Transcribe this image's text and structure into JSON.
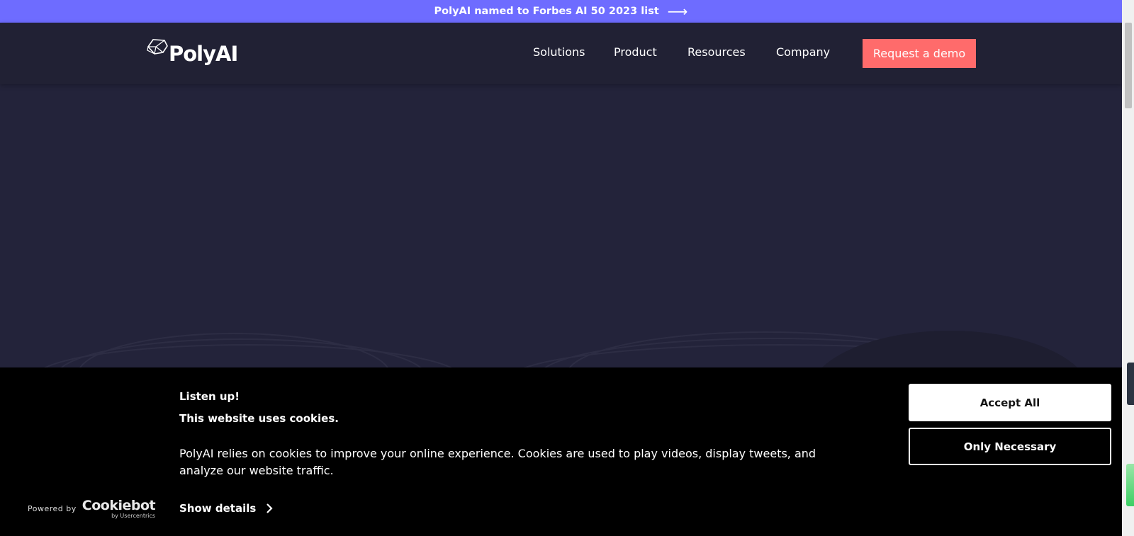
{
  "announcement": {
    "text": "PolyAI named to Forbes AI 50 2023 list",
    "arrow": "⟶"
  },
  "header": {
    "logo_text": "PolyAI",
    "nav": {
      "solutions": "Solutions",
      "product": "Product",
      "resources": "Resources",
      "company": "Company"
    },
    "cta_label": "Request a demo"
  },
  "cookie_banner": {
    "heading": "Listen up!",
    "subheading": "This website uses cookies.",
    "body": "PolyAI relies on cookies to improve your online experience. Cookies are used to play videos, display tweets, and analyze our website traffic.",
    "show_details_label": "Show details",
    "accept_all_label": "Accept All",
    "only_necessary_label": "Only Necessary",
    "powered_by_label": "Powered by",
    "cookiebot_brand": "Cookiebot",
    "cookiebot_sub": "by Usercentrics"
  },
  "colors": {
    "announcement_bg": "#6e6cff",
    "page_bg": "#23233a",
    "nav_bg": "#212134",
    "cta_bg": "#ff6b6b",
    "banner_bg": "#000000"
  },
  "icons": {
    "announcement": "arrow-right-icon",
    "logo": "polyai-polyhedron-icon",
    "show_details": "chevron-right-icon"
  }
}
